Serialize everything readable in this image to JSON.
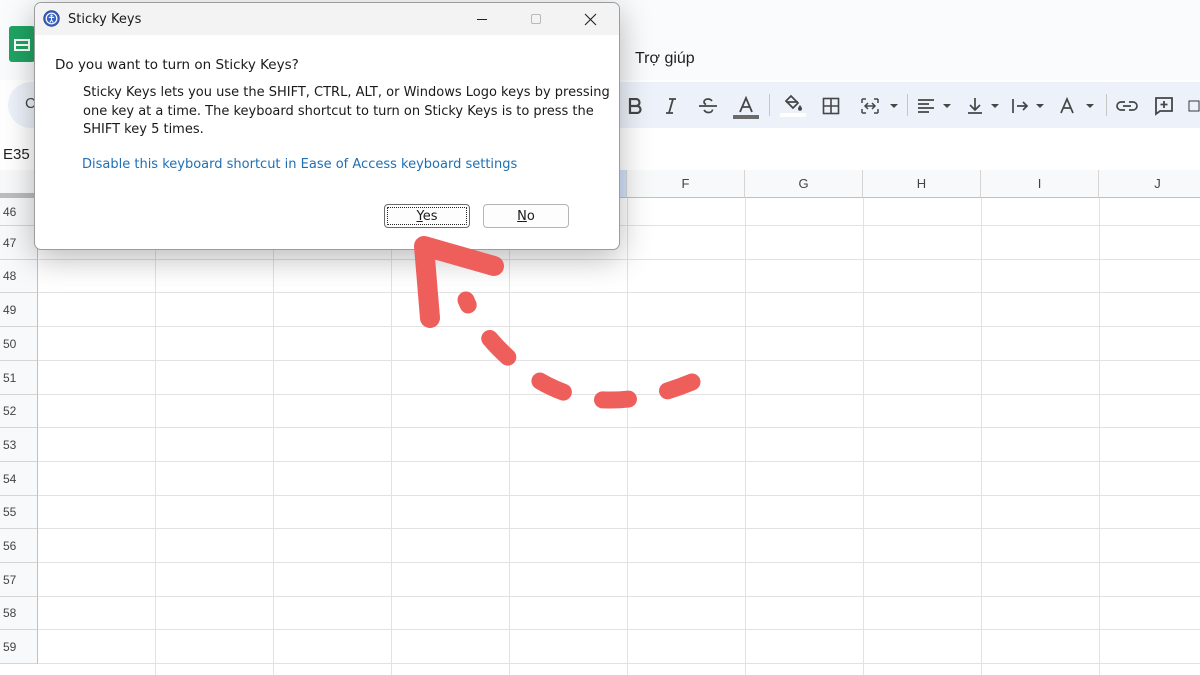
{
  "sheets": {
    "menu_help": "Trợ giúp",
    "toolbar_left_letter": "C",
    "cell_reference": "E35",
    "columns": [
      "F",
      "G",
      "H",
      "I",
      "J"
    ],
    "rows": [
      "46",
      "47",
      "48",
      "49",
      "50",
      "51",
      "52",
      "53",
      "54",
      "55",
      "56",
      "57",
      "58",
      "59"
    ],
    "toolbar_icons": [
      "bold-icon",
      "italic-icon",
      "strikethrough-icon",
      "text-color-icon",
      "fill-color-icon",
      "borders-icon",
      "merge-cells-icon",
      "horizontal-align-icon",
      "vertical-align-icon",
      "text-wrapping-icon",
      "text-rotation-icon",
      "insert-link-icon",
      "insert-comment-icon"
    ],
    "colors": {
      "brand_green": "#1fa463",
      "toolbar_bg": "#edf2fa",
      "selected_col": "#d3e3fd"
    }
  },
  "dialog": {
    "title": "Sticky Keys",
    "question": "Do you want to turn on Sticky Keys?",
    "description": "Sticky Keys lets you use the SHIFT, CTRL, ALT, or Windows Logo keys by pressing one key at a time. The keyboard shortcut to turn on Sticky Keys is to press the SHIFT key 5 times.",
    "link": "Disable this keyboard shortcut in Ease of Access keyboard settings",
    "yes_prefix": "",
    "yes_mnemonic": "Y",
    "yes_rest": "es",
    "no_mnemonic": "N",
    "no_rest": "o",
    "colors": {
      "link": "#1f6fb4",
      "annotation_arrow": "#ee5f5b"
    }
  }
}
